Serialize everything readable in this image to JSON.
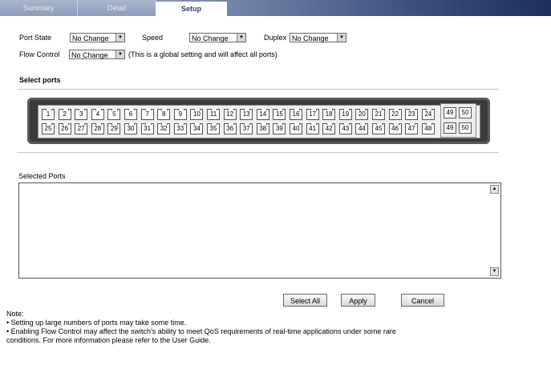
{
  "tabs": [
    {
      "label": "Summary",
      "active": false
    },
    {
      "label": "Detail",
      "active": false
    },
    {
      "label": "Setup",
      "active": true
    }
  ],
  "form": {
    "port_state_label": "Port State",
    "port_state_value": "No Change",
    "speed_label": "Speed",
    "speed_value": "No Change",
    "duplex_label": "Duplex",
    "duplex_value": "No Change",
    "flow_control_label": "Flow Control",
    "flow_control_value": "No Change",
    "flow_control_note": "(This is a global setting and will affect all ports)"
  },
  "select_ports_heading": "Select ports",
  "ports_top": [
    "1",
    "2",
    "3",
    "4",
    "5",
    "6",
    "7",
    "8",
    "9",
    "10",
    "11",
    "12",
    "13",
    "14",
    "15",
    "16",
    "17",
    "18",
    "19",
    "20",
    "21",
    "22",
    "23",
    "24"
  ],
  "ports_bottom": [
    "25",
    "26",
    "27",
    "28",
    "29",
    "30",
    "31",
    "32",
    "33",
    "34",
    "35",
    "36",
    "37",
    "38",
    "39",
    "40",
    "41",
    "42",
    "43",
    "44",
    "45",
    "46",
    "47",
    "48"
  ],
  "uplink_ports": [
    "49",
    "50",
    "49",
    "50"
  ],
  "selected_ports_label": "Selected Ports",
  "selected_ports_value": "",
  "buttons": {
    "select_all": "Select All",
    "apply": "Apply",
    "cancel": "Cancel"
  },
  "notes": {
    "title": "Note:",
    "line1": "• Setting up large numbers of ports may take some time.",
    "line2": "• Enabling Flow Control may affect the switch's ability to meet QoS requirements of real-time applications under some rare",
    "line3": "conditions. For more information please refer to the User Guide."
  },
  "colors": {
    "tab_bar_start": "#9aa9c2",
    "tab_bar_end": "#1c2f5a",
    "active_tab_text": "#2a3f74",
    "switch_body": "#3a3a3a"
  }
}
